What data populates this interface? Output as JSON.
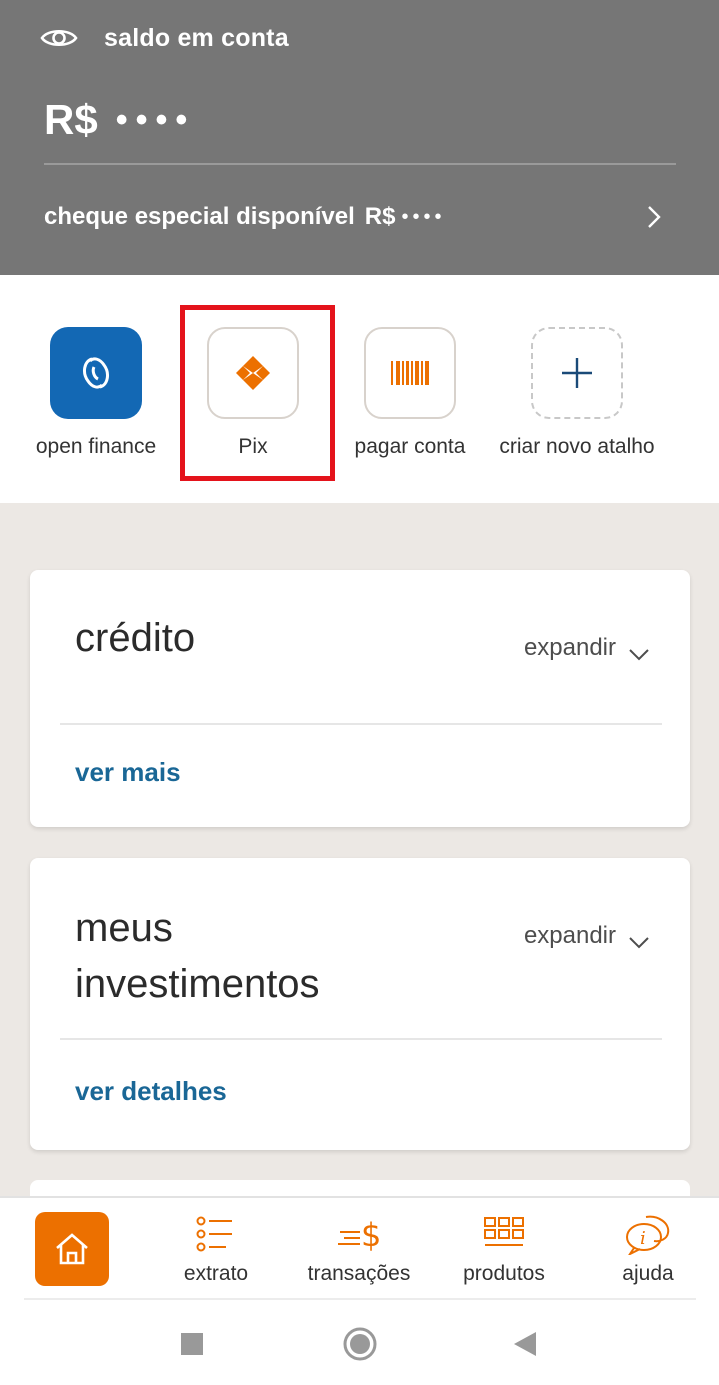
{
  "header": {
    "balance_label": "saldo em conta",
    "currency": "R$",
    "hidden_balance": "••••",
    "overdraft_label": "cheque especial disponível",
    "overdraft_currency": "R$",
    "overdraft_hidden": "••••"
  },
  "shortcuts": [
    {
      "label": "open finance",
      "icon": "open-finance-icon"
    },
    {
      "label": "Pix",
      "icon": "pix-icon"
    },
    {
      "label": "pagar conta",
      "icon": "barcode-icon"
    },
    {
      "label": "criar novo atalho",
      "icon": "plus-icon"
    }
  ],
  "cards": {
    "credit": {
      "title": "crédito",
      "expand_label": "expandir",
      "link": "ver mais"
    },
    "investments": {
      "title_line1": "meus",
      "title_line2": "investimentos",
      "expand_label": "expandir",
      "link": "ver detalhes"
    }
  },
  "bottom_nav": [
    {
      "label": "",
      "icon": "home-icon"
    },
    {
      "label": "extrato",
      "icon": "list-icon"
    },
    {
      "label": "transações",
      "icon": "dollar-transfer-icon"
    },
    {
      "label": "produtos",
      "icon": "grid-icon"
    },
    {
      "label": "ajuda",
      "icon": "help-chat-icon"
    }
  ],
  "colors": {
    "header_bg": "#767676",
    "accent_orange": "#ec7000",
    "link_blue": "#1a6796",
    "open_finance_blue": "#1368b4",
    "highlight_red": "#e4131b"
  }
}
